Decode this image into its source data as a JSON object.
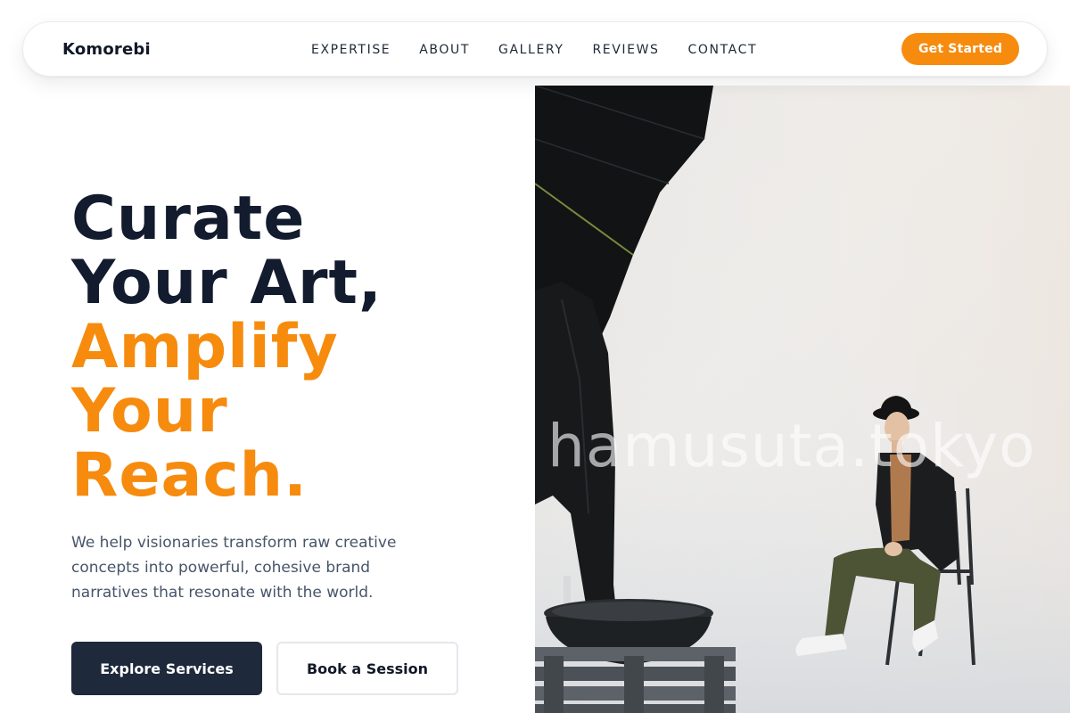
{
  "brand": {
    "name": "Komorebi"
  },
  "nav": {
    "links": [
      "EXPERTISE",
      "ABOUT",
      "GALLERY",
      "REVIEWS",
      "CONTACT"
    ],
    "cta_label": "Get Started"
  },
  "hero": {
    "headline_lines": [
      "Curate",
      "Your Art,",
      "Amplify",
      "Your",
      "Reach."
    ],
    "description": "We help visionaries transform raw creative concepts into powerful, cohesive brand narratives that resonate with the world.",
    "primary_button": "Explore Services",
    "secondary_button": "Book a Session",
    "image": {
      "watermark": "hamusuta.tokyo"
    }
  },
  "colors": {
    "accent": "#f68b0e",
    "heading_dark": "#131b2e",
    "button_dark": "#1e293b",
    "body_text": "#475569"
  }
}
